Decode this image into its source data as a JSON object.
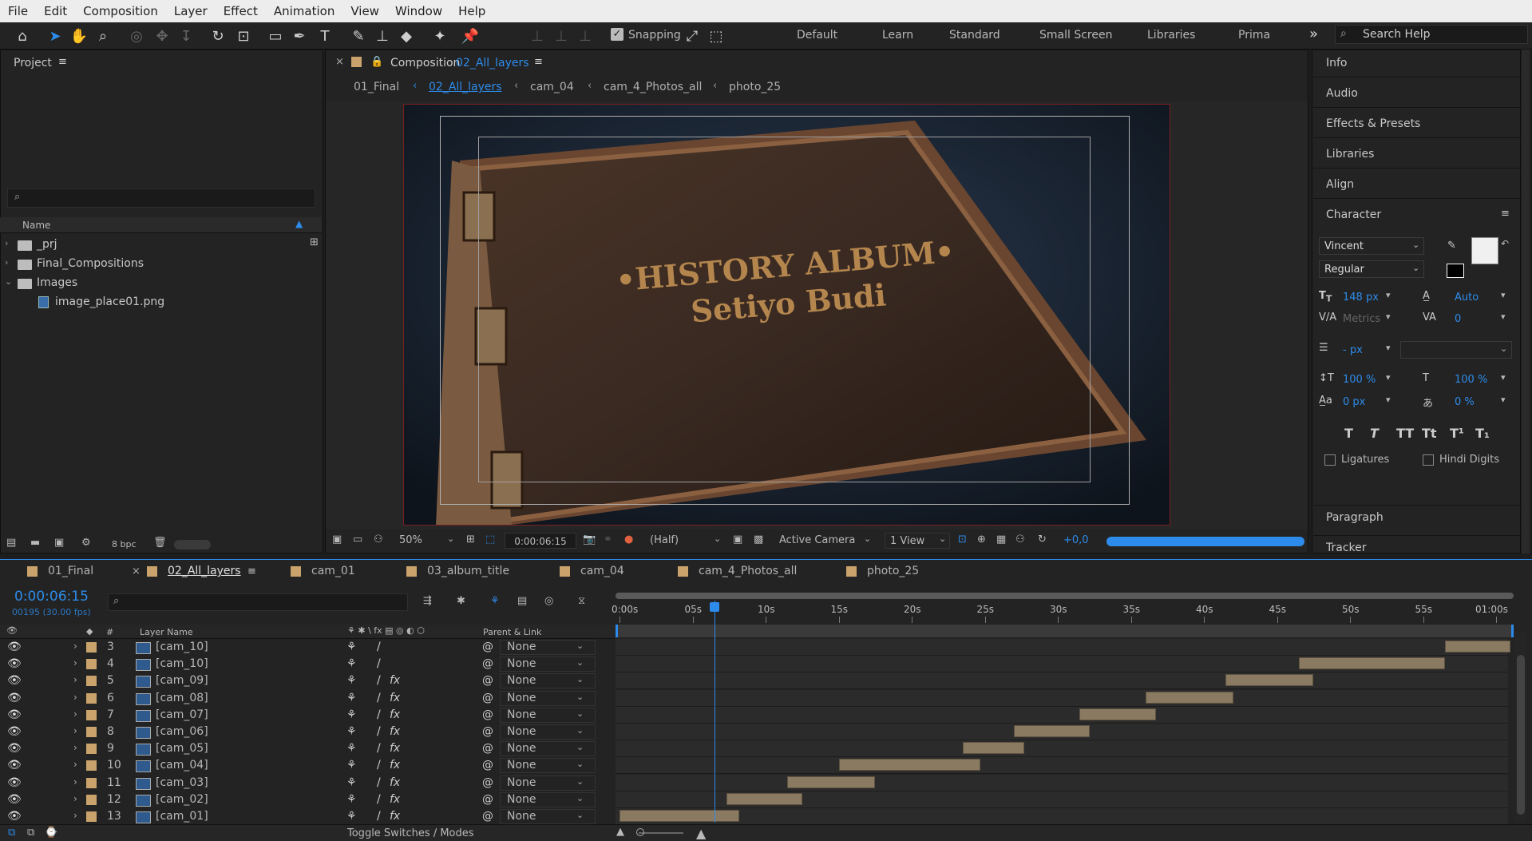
{
  "menu": [
    "File",
    "Edit",
    "Composition",
    "Layer",
    "Effect",
    "Animation",
    "View",
    "Window",
    "Help"
  ],
  "toolbar": {
    "snapping_label": "Snapping",
    "workspaces": [
      "Default",
      "Learn",
      "Standard",
      "Small Screen",
      "Libraries",
      "Prima"
    ],
    "overflow": "»",
    "search_placeholder": "Search Help"
  },
  "project": {
    "title": "Project",
    "column_name": "Name",
    "items": [
      {
        "label": "_prj",
        "type": "folder"
      },
      {
        "label": "Final_Compositions",
        "type": "folder"
      },
      {
        "label": "Images",
        "type": "folder"
      },
      {
        "label": "image_place01.png",
        "type": "file"
      }
    ],
    "bpc": "8 bpc"
  },
  "composition": {
    "title_prefix": "Composition",
    "title_name": "02_All_layers",
    "breadcrumbs": [
      "01_Final",
      "02_All_layers",
      "cam_04",
      "cam_4_Photos_all",
      "photo_25"
    ],
    "viewer_title_line1": "•HISTORY ALBUM•",
    "viewer_title_line2": "Setiyo Budi",
    "zoom": "50%",
    "timecode": "0:00:06:15",
    "resolution": "(Half)",
    "camera": "Active Camera",
    "views": "1 View",
    "exposure": "+0,0"
  },
  "right_panels": [
    "Info",
    "Audio",
    "Effects & Presets",
    "Libraries",
    "Align"
  ],
  "character": {
    "title": "Character",
    "font": "Vincent",
    "style": "Regular",
    "size": "148 px",
    "leading": "Auto",
    "kerning": "Metrics",
    "tracking": "0",
    "stroke": "- px",
    "vscale": "100 %",
    "hscale": "100 %",
    "baseline": "0 px",
    "tsume": "0 %",
    "styles": [
      "T",
      "T",
      "TT",
      "Tt",
      "T¹",
      "T₁"
    ],
    "ligatures": "Ligatures",
    "hindi": "Hindi Digits"
  },
  "bottom_right_panels": [
    "Paragraph",
    "Tracker"
  ],
  "timeline": {
    "tabs": [
      "01_Final",
      "02_All_layers",
      "cam_01",
      "03_album_title",
      "cam_04",
      "cam_4_Photos_all",
      "photo_25"
    ],
    "active_tab": "02_All_layers",
    "timecode": "0:00:06:15",
    "frames": "00195 (30.00 fps)",
    "col_num": "#",
    "col_layer": "Layer Name",
    "col_parent": "Parent & Link",
    "ruler": [
      "0:00s",
      "05s",
      "10s",
      "15s",
      "20s",
      "25s",
      "30s",
      "35s",
      "40s",
      "45s",
      "50s",
      "55s",
      "01:00s"
    ],
    "footer": "Toggle Switches / Modes",
    "playhead_seconds": 6.5,
    "layers": [
      {
        "num": "3",
        "name": "[cam_10]",
        "fx": false,
        "parent": "None",
        "start": 56.5,
        "end": 61
      },
      {
        "num": "4",
        "name": "[cam_10]",
        "fx": false,
        "parent": "None",
        "start": 46.5,
        "end": 56.5
      },
      {
        "num": "5",
        "name": "[cam_09]",
        "fx": true,
        "parent": "None",
        "start": 41.5,
        "end": 47.5
      },
      {
        "num": "6",
        "name": "[cam_08]",
        "fx": true,
        "parent": "None",
        "start": 36,
        "end": 42
      },
      {
        "num": "7",
        "name": "[cam_07]",
        "fx": true,
        "parent": "None",
        "start": 31.5,
        "end": 36.7
      },
      {
        "num": "8",
        "name": "[cam_06]",
        "fx": true,
        "parent": "None",
        "start": 27,
        "end": 32.2
      },
      {
        "num": "9",
        "name": "[cam_05]",
        "fx": true,
        "parent": "None",
        "start": 23.5,
        "end": 27.7
      },
      {
        "num": "10",
        "name": "[cam_04]",
        "fx": true,
        "parent": "None",
        "start": 15,
        "end": 24.7
      },
      {
        "num": "11",
        "name": "[cam_03]",
        "fx": true,
        "parent": "None",
        "start": 11.5,
        "end": 17.5
      },
      {
        "num": "12",
        "name": "[cam_02]",
        "fx": true,
        "parent": "None",
        "start": 7.3,
        "end": 12.5
      },
      {
        "num": "13",
        "name": "[cam_01]",
        "fx": true,
        "parent": "None",
        "start": 0,
        "end": 8.2
      }
    ]
  },
  "colors": {
    "accent": "#2d8ceb",
    "layer_swatch": "#c9a36b",
    "bar": "#8a7a62"
  }
}
